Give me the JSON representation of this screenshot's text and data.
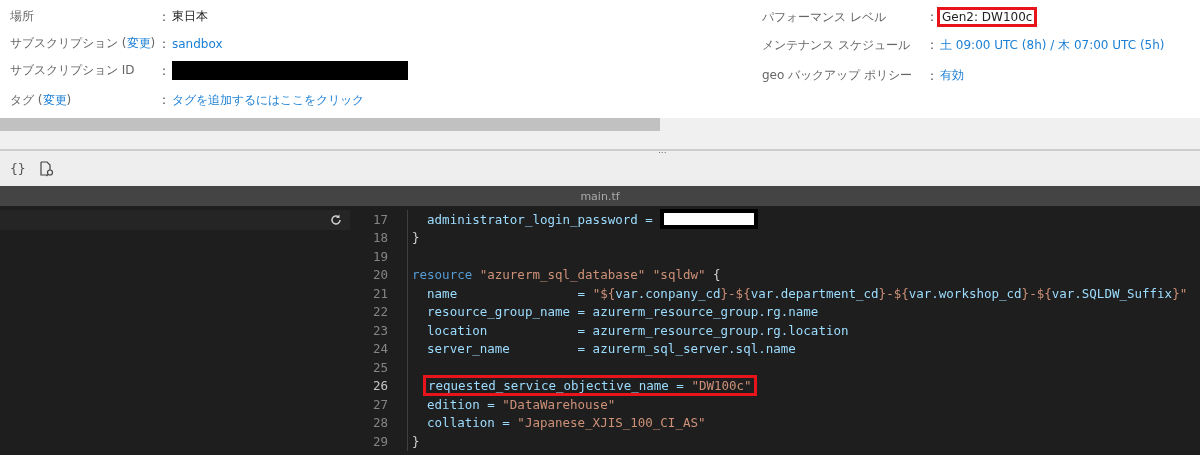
{
  "essentials": {
    "left": [
      {
        "label": "場所",
        "value": {
          "kind": "text",
          "text": "東日本"
        }
      },
      {
        "label": "サブスクリプション (",
        "link": "変更",
        "label_end": ")",
        "value": {
          "kind": "link",
          "text": "sandbox"
        }
      },
      {
        "label": "サブスクリプション ID",
        "value": {
          "kind": "redacted"
        }
      },
      {
        "label": "タグ (",
        "link": "変更",
        "label_end": ")",
        "value": {
          "kind": "link",
          "text": "タグを追加するにはここをクリック"
        }
      }
    ],
    "right": [
      {
        "label": "パフォーマンス レベル",
        "value": {
          "kind": "highlighted",
          "text": "Gen2: DW100c"
        }
      },
      {
        "label": "メンテナンス スケジュール",
        "value": {
          "kind": "link",
          "text": "土 09:00 UTC (8h) / 木 07:00 UTC (5h)"
        }
      },
      {
        "label": "geo バックアップ ポリシー",
        "value": {
          "kind": "link",
          "text": "有効"
        }
      }
    ]
  },
  "separator": ":",
  "splitter_grip": "...",
  "toolbar": [
    {
      "kind": "braces",
      "text": "{}"
    },
    {
      "kind": "file-search"
    }
  ],
  "editor": {
    "tab_title": "main.tf",
    "lines": [
      {
        "number": "17",
        "highlighted": false,
        "redacted_value": true,
        "tokens": [
          {
            "kind": "ident",
            "text": "  administrator_login_password = "
          }
        ]
      },
      {
        "number": "18",
        "highlighted": false,
        "tokens": [
          {
            "kind": "punct",
            "text": "}"
          }
        ]
      },
      {
        "number": "19",
        "highlighted": false
      },
      {
        "number": "20",
        "highlighted": false,
        "tokens": [
          {
            "kind": "kw",
            "text": "resource "
          },
          {
            "kind": "str",
            "text": "\"azurerm_sql_database\" \"sqldw\""
          },
          {
            "kind": "punct",
            "text": " {"
          }
        ]
      },
      {
        "number": "21",
        "highlighted": false,
        "tokens": [
          {
            "kind": "ident",
            "text": "  name                = "
          },
          {
            "kind": "str",
            "text": "\"${"
          },
          {
            "kind": "ident",
            "text": "var.conpany_cd"
          },
          {
            "kind": "str",
            "text": "}-${"
          },
          {
            "kind": "ident",
            "text": "var.department_cd"
          },
          {
            "kind": "str",
            "text": "}-${"
          },
          {
            "kind": "ident",
            "text": "var.workshop_cd"
          },
          {
            "kind": "str",
            "text": "}-${"
          },
          {
            "kind": "ident",
            "text": "var.SQLDW_Suffix"
          },
          {
            "kind": "str",
            "text": "}\""
          }
        ]
      },
      {
        "number": "22",
        "highlighted": false,
        "tokens": [
          {
            "kind": "ident",
            "text": "  resource_group_name = azurerm_resource_group.rg.name"
          }
        ]
      },
      {
        "number": "23",
        "highlighted": false,
        "tokens": [
          {
            "kind": "ident",
            "text": "  location            = azurerm_resource_group.rg.location"
          }
        ]
      },
      {
        "number": "24",
        "highlighted": false,
        "tokens": [
          {
            "kind": "ident",
            "text": "  server_name         = azurerm_sql_server.sql.name"
          }
        ]
      },
      {
        "number": "25",
        "highlighted": false
      },
      {
        "number": "26",
        "highlighted": true,
        "tokens": [
          {
            "kind": "ident",
            "text": "requested_service_objective_name = "
          },
          {
            "kind": "str",
            "text": "\"DW100c\""
          }
        ]
      },
      {
        "number": "27",
        "highlighted": false,
        "tokens": [
          {
            "kind": "ident",
            "text": "  edition = "
          },
          {
            "kind": "str",
            "text": "\"DataWarehouse\""
          }
        ]
      },
      {
        "number": "28",
        "highlighted": false,
        "tokens": [
          {
            "kind": "ident",
            "text": "  collation = "
          },
          {
            "kind": "str",
            "text": "\"Japanese_XJIS_100_CI_AS\""
          }
        ]
      },
      {
        "number": "29",
        "highlighted": false,
        "tokens": [
          {
            "kind": "punct",
            "text": "}"
          }
        ]
      }
    ]
  }
}
